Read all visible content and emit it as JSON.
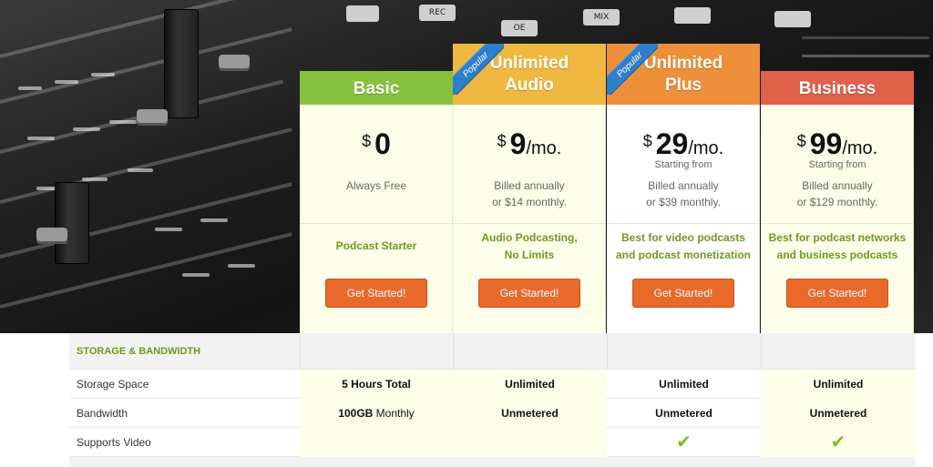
{
  "plans": [
    {
      "name_line1": "Basic",
      "name_line2": "",
      "color": "#86c23b",
      "popular": "",
      "currency": "$",
      "price": "0",
      "period": "",
      "starting": "",
      "billing_line1": "Always Free",
      "billing_line2": "",
      "tagline_line1": "Podcast Starter",
      "tagline_line2": "",
      "cta": "Get Started!"
    },
    {
      "name_line1": "Unlimited",
      "name_line2": "Audio",
      "color": "#f0b840",
      "popular": "Popular",
      "currency": "$",
      "price": "9",
      "period": "/mo.",
      "starting": "",
      "billing_line1": "Billed annually",
      "billing_line2": "or $14 monthly.",
      "tagline_line1": "Audio Podcasting,",
      "tagline_line2": "No Limits",
      "cta": "Get Started!"
    },
    {
      "name_line1": "Unlimited",
      "name_line2": "Plus",
      "color": "#ee8f3a",
      "popular": "Popular",
      "currency": "$",
      "price": "29",
      "period": "/mo.",
      "starting": "Starting from",
      "billing_line1": "Billed annually",
      "billing_line2": "or $39 monthly.",
      "tagline_line1": "Best for video podcasts",
      "tagline_line2": "and podcast monetization",
      "cta": "Get Started!"
    },
    {
      "name_line1": "Business",
      "name_line2": "",
      "color": "#e2614a",
      "popular": "",
      "currency": "$",
      "price": "99",
      "period": "/mo.",
      "starting": "Starting from",
      "billing_line1": "Billed annually",
      "billing_line2": "or $129 monthly.",
      "tagline_line1": "Best for podcast networks",
      "tagline_line2": "and business podcasts",
      "cta": "Get Started!"
    }
  ],
  "features": {
    "section_title": "STORAGE & BANDWIDTH",
    "section_color": "#6f9a1c",
    "rows": [
      {
        "label": "Storage Space",
        "basic_bold": "5 Hours Total",
        "basic_rest": "",
        "audio": "Unlimited",
        "plus": "Unlimited",
        "business": "Unlimited"
      },
      {
        "label": "Bandwidth",
        "basic_bold": "100GB",
        "basic_rest": " Monthly",
        "audio": "Unmetered",
        "plus": "Unmetered",
        "business": "Unmetered"
      },
      {
        "label": "Supports Video",
        "basic_bold": "",
        "basic_rest": "",
        "audio": "",
        "plus": "✔",
        "business": "✔"
      }
    ]
  },
  "hero_keys": [
    "OE",
    "MIX",
    "REC"
  ]
}
